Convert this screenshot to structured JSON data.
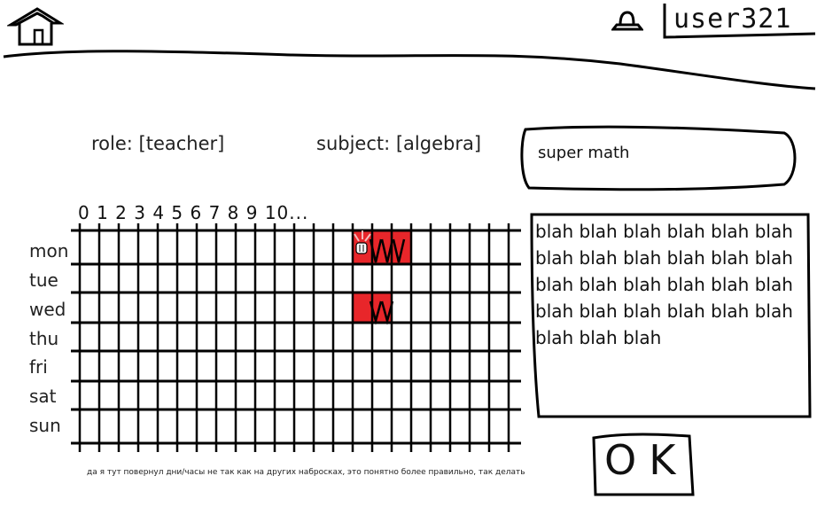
{
  "header": {
    "home_icon": "home-icon",
    "user_icon": "user-icon",
    "username": "user321"
  },
  "form": {
    "role_text": "role: [teacher]",
    "subject_text": "subject: [algebra]",
    "title_value": "super math",
    "description": "blah blah blah blah blah blah blah blah blah blah blah blah blah blah blah blah blah blah blah blah blah blah blah blah blah blah blah"
  },
  "schedule": {
    "hours_label": "0 1 2 3 4 5 6 7  8 9 10...",
    "days": [
      "mon",
      "tue",
      "wed",
      "thu",
      "fri",
      "sat",
      "sun"
    ],
    "selected_slots": [
      {
        "day": "mon",
        "hours": [
          14,
          15,
          16
        ],
        "mark": "VVV"
      },
      {
        "day": "wed",
        "hours": [
          14,
          15
        ],
        "mark": "VV"
      }
    ],
    "cursor_icon": "hand-pointer-icon"
  },
  "ok_label": "OK",
  "note": "да я тут повернул дни/часы не так как на других набросках, это понятно более правильно, так делать",
  "colors": {
    "selected": "#e8262a",
    "ink": "#000000"
  }
}
